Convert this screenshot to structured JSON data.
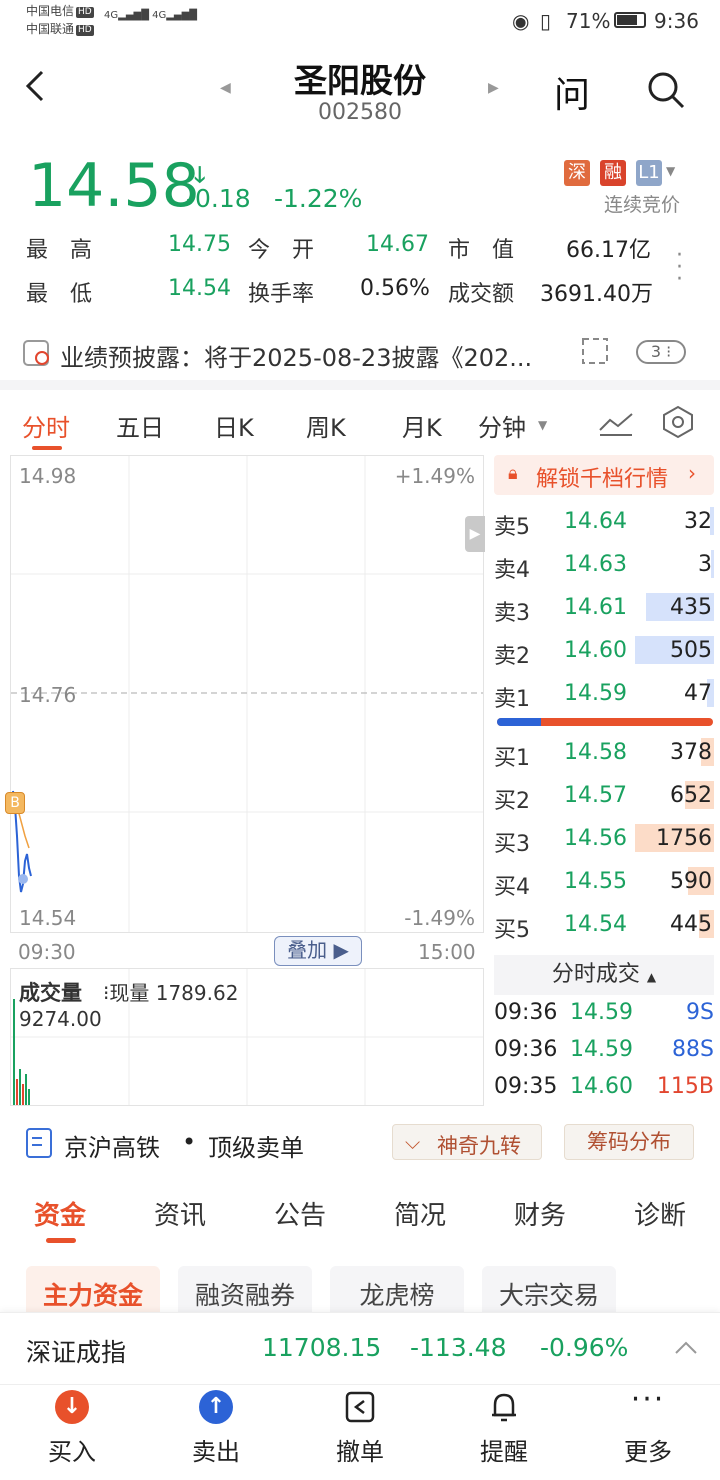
{
  "status_bar": {
    "carrier1": "中国电信",
    "carrier2": "中国联通",
    "hd": "HD",
    "network": "4G",
    "battery": "71%",
    "time": "9:36"
  },
  "header": {
    "title": "圣阳股份",
    "code": "002580",
    "ask_label": "问"
  },
  "quote": {
    "price": "14.58",
    "change": "-0.18",
    "change_pct": "-1.22%",
    "tags": [
      "深",
      "融",
      "L1"
    ],
    "trading_status": "连续竞价",
    "stats": [
      {
        "label": "最　高",
        "value": "14.75",
        "color": "green"
      },
      {
        "label": "今　开",
        "value": "14.67",
        "color": "green"
      },
      {
        "label": "市　值",
        "value": "66.17亿",
        "color": "black"
      },
      {
        "label": "最　低",
        "value": "14.54",
        "color": "green"
      },
      {
        "label": "换手率",
        "value": "0.56%",
        "color": "black"
      },
      {
        "label": "成交额",
        "value": "3691.40万",
        "color": "black"
      }
    ]
  },
  "notice": {
    "text": "业绩预披露：将于2025-08-23披露《202...",
    "count": "3"
  },
  "chart_tabs": [
    "分时",
    "五日",
    "日K",
    "周K",
    "月K",
    "分钟"
  ],
  "chart": {
    "y_top": "14.98",
    "y_mid": "14.76",
    "y_bottom": "14.54",
    "pct_top": "+1.49%",
    "pct_bottom": "-1.49%",
    "time_start": "09:30",
    "time_end": "15:00",
    "overlay_label": "叠加",
    "b_marker": "B",
    "volume_title": "成交量",
    "volume_now": "现量 1789.62",
    "volume_max": "9274.00"
  },
  "orderbook": {
    "unlock_label": "解锁千档行情",
    "asks": [
      {
        "label": "卖5",
        "price": "14.64",
        "qty": "32",
        "bar": 0.02
      },
      {
        "label": "卖4",
        "price": "14.63",
        "qty": "3",
        "bar": 0.0
      },
      {
        "label": "卖3",
        "price": "14.61",
        "qty": "435",
        "bar": 0.31
      },
      {
        "label": "卖2",
        "price": "14.60",
        "qty": "505",
        "bar": 0.36
      },
      {
        "label": "卖1",
        "price": "14.59",
        "qty": "47",
        "bar": 0.03
      }
    ],
    "bids": [
      {
        "label": "买1",
        "price": "14.58",
        "qty": "378",
        "bar": 0.06
      },
      {
        "label": "买2",
        "price": "14.57",
        "qty": "652",
        "bar": 0.13
      },
      {
        "label": "买3",
        "price": "14.56",
        "qty": "1756",
        "bar": 0.36
      },
      {
        "label": "买4",
        "price": "14.55",
        "qty": "590",
        "bar": 0.12
      },
      {
        "label": "买5",
        "price": "14.54",
        "qty": "445",
        "bar": 0.07
      }
    ],
    "ticks_title": "分时成交",
    "ticks": [
      {
        "time": "09:36",
        "price": "14.59",
        "vol": "9S",
        "side": "S"
      },
      {
        "time": "09:36",
        "price": "14.59",
        "vol": "88S",
        "side": "S"
      },
      {
        "time": "09:35",
        "price": "14.60",
        "vol": "115B",
        "side": "B"
      }
    ]
  },
  "concepts": {
    "text1": "京沪高铁",
    "text2": "顶级卖单",
    "magic_label": "神奇九转",
    "chip_label": "筹码分布"
  },
  "sub_tabs": [
    "资金",
    "资讯",
    "公告",
    "简况",
    "财务",
    "诊断"
  ],
  "chips": [
    "主力资金",
    "融资融券",
    "龙虎榜",
    "大宗交易"
  ],
  "index": {
    "name": "深证成指",
    "value": "11708.15",
    "change": "-113.48",
    "pct": "-0.96%"
  },
  "bottom_nav": [
    "买入",
    "卖出",
    "撤单",
    "提醒",
    "更多"
  ],
  "colors": {
    "down": "#19a15f",
    "up": "#e2462f",
    "accent": "#e8512b"
  }
}
